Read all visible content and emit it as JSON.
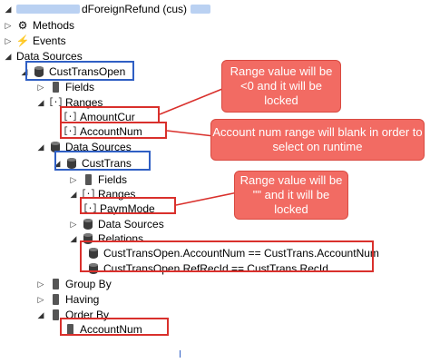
{
  "title": {
    "visible_text": "dForeignRefund (cus)"
  },
  "tree": {
    "methods": "Methods",
    "events": "Events",
    "data_sources": "Data Sources",
    "cust_trans_open": "CustTransOpen",
    "fields": "Fields",
    "ranges": "Ranges",
    "amount_cur": "AmountCur",
    "account_num": "AccountNum",
    "inner_data_sources": "Data Sources",
    "cust_trans": "CustTrans",
    "ct_fields": "Fields",
    "ct_ranges": "Ranges",
    "paym_mode": "PaymMode",
    "ct_data_sources": "Data Sources",
    "relations": "Relations",
    "relation_1": "CustTransOpen.AccountNum == CustTrans.AccountNum",
    "relation_2": "CustTransOpen.RefRecId == CustTrans.RecId",
    "group_by": "Group By",
    "having": "Having",
    "order_by": "Order By",
    "order_account_num": "AccountNum"
  },
  "callouts": {
    "range_locked": "Range value will be <0 and it will be locked",
    "account_blank": "Account num range will blank in order to select on runtime",
    "paym_locked": "Range value will be \"\" and it will be locked"
  },
  "colors": {
    "highlight_red": "#d9302c",
    "highlight_blue": "#2f5fc4",
    "callout_fill": "#f26b63"
  }
}
